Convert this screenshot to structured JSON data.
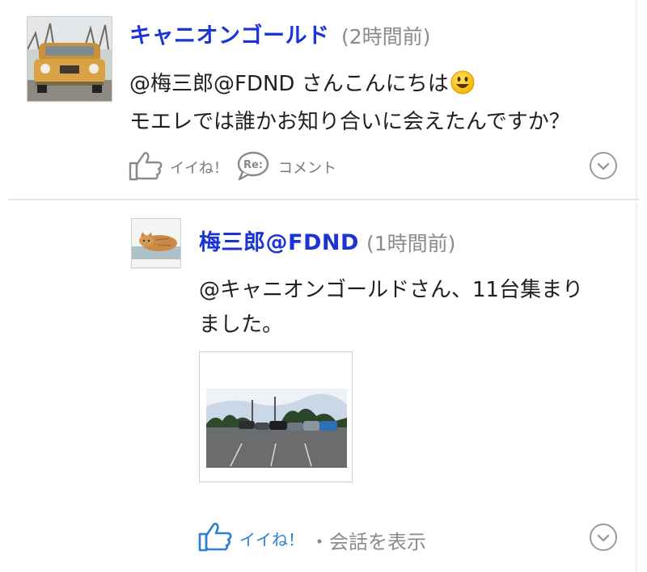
{
  "posts": [
    {
      "author": "キャニオンゴールド",
      "time": "(2時間前)",
      "lines": [
        "@梅三郎@FDND さんこんにちは",
        "モエレでは誰かお知り合いに会えたんですか？"
      ],
      "like_label": "イイね！",
      "comment_label": "コメント",
      "emoji": "smiley-emoji"
    },
    {
      "author": "梅三郎@FDND",
      "time": "(1時間前)",
      "lines": [
        "@キャニオンゴールドさん、11台集まり",
        "ました。"
      ],
      "like_label": "イイね！",
      "conversation_label": "・会話を表示"
    }
  ],
  "colors": {
    "author": "#1a34d6",
    "liked": "#2d7fd0",
    "muted": "#8a8a8a"
  }
}
